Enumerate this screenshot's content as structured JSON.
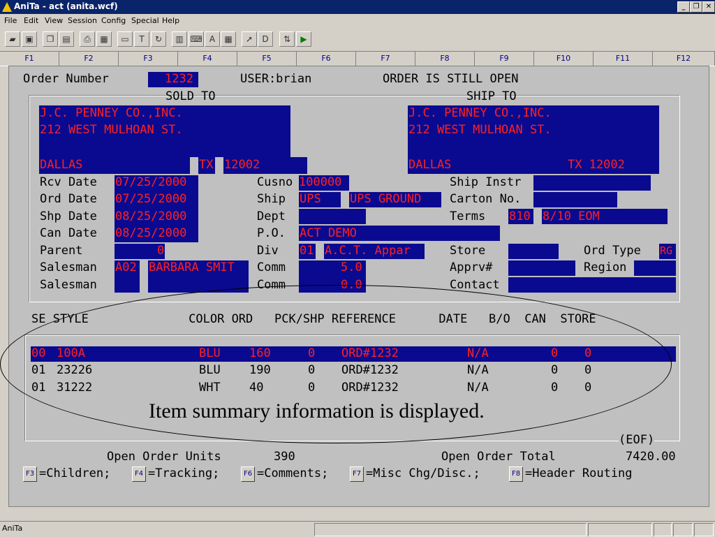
{
  "window": {
    "title": "AniTa - act (anita.wcf)",
    "min": "_",
    "max": "❐",
    "close": "✕"
  },
  "menu": [
    "File",
    "Edit",
    "View",
    "Session",
    "Config",
    "Special",
    "Help"
  ],
  "toolbar_icons": [
    "open-folder-icon",
    "save-icon",
    "copy-icon",
    "paste-icon",
    "print-icon",
    "print-setup-icon",
    "screen-icon",
    "text-icon",
    "refresh-icon",
    "terminal-icon",
    "keyboard-icon",
    "font-icon",
    "grid-icon",
    "pointer-icon",
    "dos-icon",
    "transfer-icon",
    "play-icon"
  ],
  "fkeys": [
    "F1",
    "F2",
    "F3",
    "F4",
    "F5",
    "F6",
    "F7",
    "F8",
    "F9",
    "F10",
    "F11",
    "F12"
  ],
  "order": {
    "number_label": "Order Number",
    "number": "1232",
    "user": "USER:brian",
    "status": "ORDER IS STILL OPEN",
    "sold_to_label": "SOLD TO",
    "ship_to_label": "SHIP TO",
    "sold_name": "J.C. PENNEY CO.,INC.",
    "sold_addr": "212 WEST MULHOAN ST.",
    "sold_city": "DALLAS",
    "sold_state": "TX",
    "sold_zip": "12002",
    "ship_name": "J.C. PENNEY CO.,INC.",
    "ship_addr": "212 WEST MULHOAN ST.",
    "ship_city": "DALLAS",
    "ship_statezip": "TX 12002"
  },
  "fields": {
    "rcv_label": "Rcv Date",
    "rcv": "07/25/2000",
    "ord_label": "Ord Date",
    "ord": "07/25/2000",
    "shp_label": "Shp Date",
    "shp": "08/25/2000",
    "can_label": "Can Date",
    "can": "08/25/2000",
    "parent_label": "Parent",
    "parent": "0",
    "salesman_label": "Salesman",
    "salesman_code": "A02",
    "salesman_name": "BARBARA SMIT",
    "salesman2_label": "Salesman",
    "cusno_label": "Cusno",
    "cusno": "100000",
    "ship_label": "Ship",
    "ship_code": "UPS",
    "ship_desc": "UPS GROUND",
    "dept_label": "Dept",
    "po_label": "P.O.",
    "po": "ACT DEMO",
    "div_label": "Div",
    "div_code": "01",
    "div_name": "A.C.T. Appar",
    "comm_label": "Comm",
    "comm": "5.0",
    "comm2_label": "Comm",
    "comm2": "0.0",
    "shipinstr_label": "Ship Instr",
    "carton_label": "Carton No.",
    "terms_label": "Terms",
    "terms_code": "810",
    "terms_desc": "8/10 EOM",
    "store_label": "Store",
    "ordtype_label": "Ord Type",
    "ordtype": "RG",
    "apprv_label": "Apprv#",
    "region_label": "Region",
    "contact_label": "Contact"
  },
  "table": {
    "header": "SE STYLE              COLOR ORD   PCK/SHP REFERENCE      DATE   B/O  CAN  STORE",
    "rows": [
      {
        "se": "00",
        "style": "100A",
        "color": "BLU",
        "ord": "160",
        "pck": "0",
        "ref": "ORD#1232",
        "date": "N/A",
        "bo": "0",
        "can": "0"
      },
      {
        "se": "01",
        "style": "23226",
        "color": "BLU",
        "ord": "190",
        "pck": "0",
        "ref": "ORD#1232",
        "date": "N/A",
        "bo": "0",
        "can": "0"
      },
      {
        "se": "01",
        "style": "31222",
        "color": "WHT",
        "ord": "40",
        "pck": "0",
        "ref": "ORD#1232",
        "date": "N/A",
        "bo": "0",
        "can": "0"
      }
    ],
    "eof": "(EOF)"
  },
  "totals": {
    "units_label": "Open Order Units",
    "units": "390",
    "total_label": "Open Order Total",
    "total": "7420.00"
  },
  "fkey_help": [
    {
      "key": "F3",
      "text": "=Children;"
    },
    {
      "key": "F4",
      "text": "=Tracking;"
    },
    {
      "key": "F6",
      "text": "=Comments;"
    },
    {
      "key": "F7",
      "text": "=Misc Chg/Disc.;"
    },
    {
      "key": "F8",
      "text": "=Header Routing"
    }
  ],
  "callout": "Item summary information is displayed.",
  "status": {
    "app": "AniTa"
  },
  "colors": {
    "field_bg": "#0a0a90",
    "field_fg": "#ff2020",
    "title_bg": "#0a246a"
  }
}
